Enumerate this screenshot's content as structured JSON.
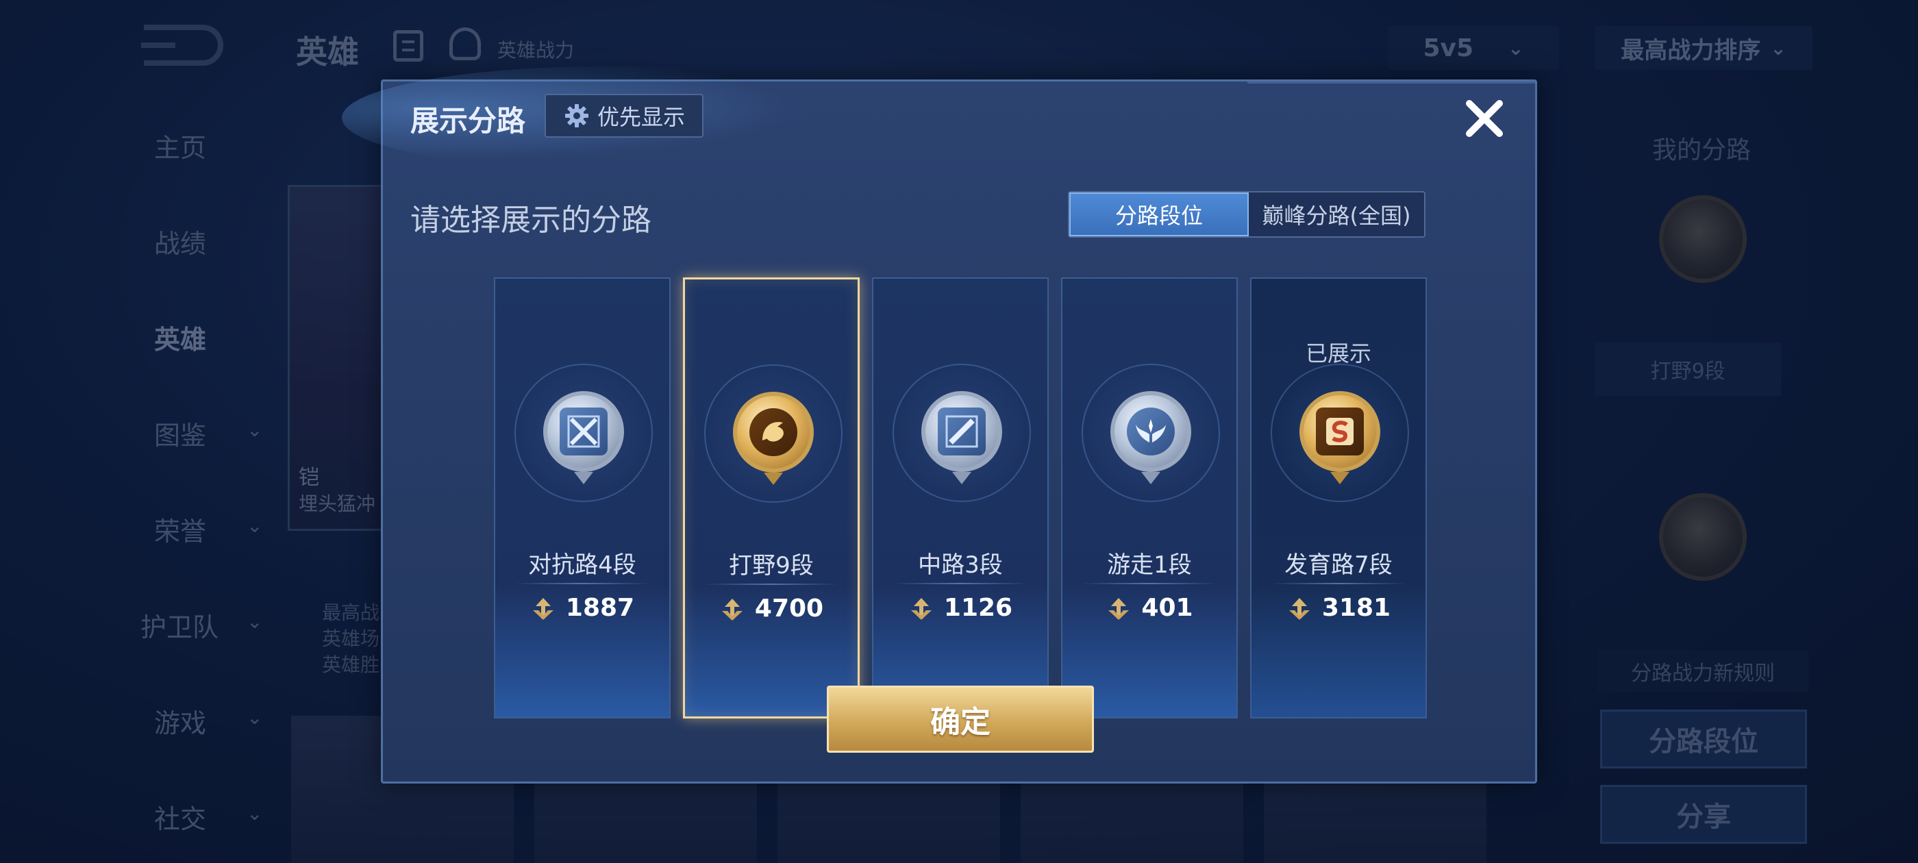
{
  "background": {
    "top_title": "英雄",
    "hero_power_label": "英雄战力",
    "mode_select": "5v5",
    "sort_select": "最高战力排序",
    "nav": [
      "主页",
      "战绩",
      "英雄",
      "图鉴",
      "荣誉",
      "护卫队",
      "游戏",
      "社交"
    ],
    "active_nav": "英雄",
    "hero_card": {
      "name": "铠",
      "subtitle": "埋头猛冲"
    },
    "hero_stats": [
      "最高战",
      "英雄场",
      "英雄胜"
    ],
    "right_panel": {
      "title": "我的分路",
      "lane_label": "打野9段",
      "rule_label": "分路战力新规则",
      "lane_rank_button": "分路段位",
      "share_button": "分享"
    }
  },
  "dialog": {
    "title": "展示分路",
    "priority_label": "优先显示",
    "prompt": "请选择展示的分路",
    "tabs": [
      {
        "label": "分路段位",
        "active": true
      },
      {
        "label": "巅峰分路(全国)",
        "active": false
      }
    ],
    "lanes": [
      {
        "name": "对抗路4段",
        "score": "1887",
        "emblem": "clash-lane-emblem-icon",
        "tier": "silver",
        "selected": false,
        "shown_label": ""
      },
      {
        "name": "打野9段",
        "score": "4700",
        "emblem": "jungle-dragon-emblem-icon",
        "tier": "gold",
        "selected": true,
        "shown_label": ""
      },
      {
        "name": "中路3段",
        "score": "1126",
        "emblem": "mid-lane-emblem-icon",
        "tier": "silver",
        "selected": false,
        "shown_label": ""
      },
      {
        "name": "游走1段",
        "score": "401",
        "emblem": "roam-wings-emblem-icon",
        "tier": "silver",
        "selected": false,
        "shown_label": ""
      },
      {
        "name": "发育路7段",
        "score": "3181",
        "emblem": "farm-lane-emblem-icon",
        "tier": "gold",
        "selected": false,
        "shown_label": "已展示"
      }
    ],
    "confirm_label": "确定"
  },
  "colors": {
    "accent_blue": "#3a70bb",
    "gold": "#d2a95b",
    "selected_border": "#f0d7a0"
  }
}
